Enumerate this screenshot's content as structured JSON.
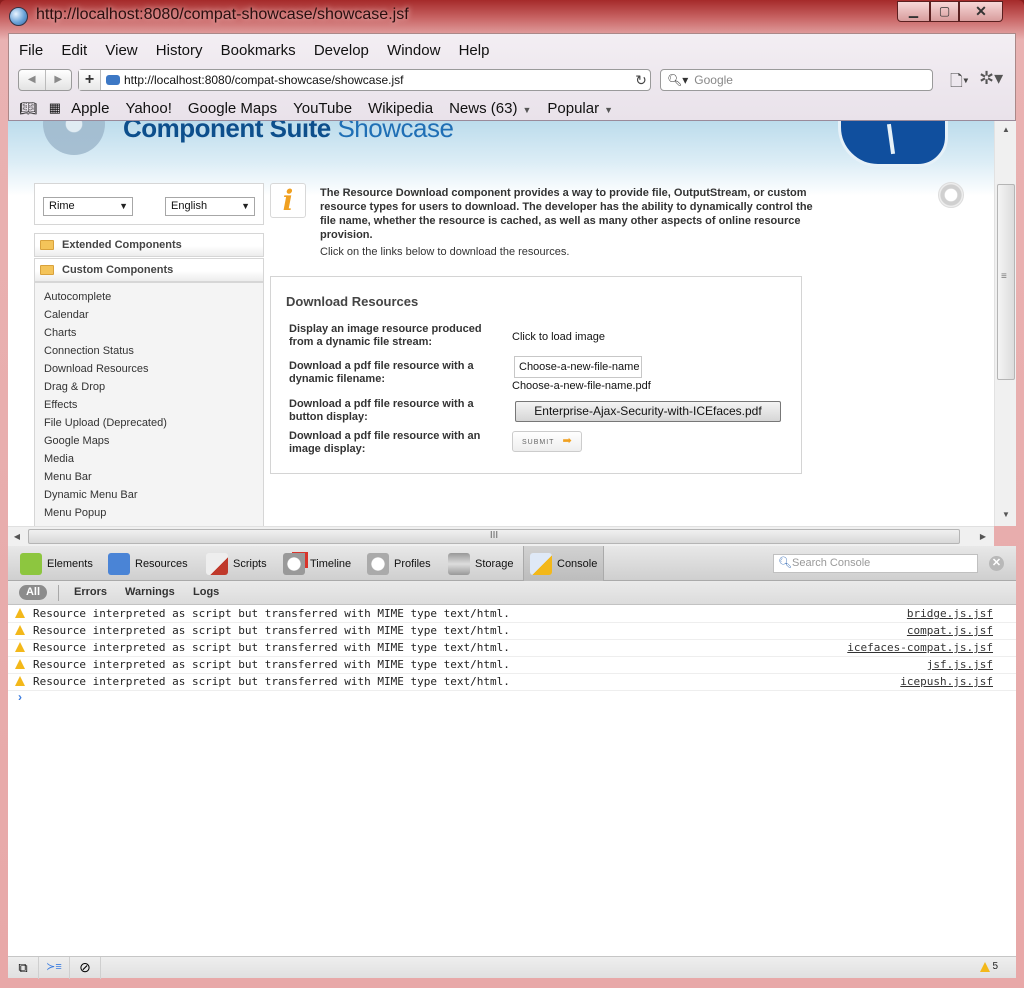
{
  "window": {
    "title": "http://localhost:8080/compat-showcase/showcase.jsf",
    "controls": {
      "minimize": "▁",
      "maximize": "▢",
      "close": "✕"
    }
  },
  "menubar": [
    "File",
    "Edit",
    "View",
    "History",
    "Bookmarks",
    "Develop",
    "Window",
    "Help"
  ],
  "toolbar": {
    "back_icon": "◀",
    "forward_icon": "▶",
    "add_icon": "+",
    "url": "http://localhost:8080/compat-showcase/showcase.jsf",
    "reload_icon": "↻",
    "search_icon": "🔍︎▾",
    "search_placeholder": "Google",
    "page_menu_icon": "🗋▾",
    "settings_icon": "✲▾"
  },
  "bookmarks": {
    "book_icon": "📖︎",
    "grid_icon": "▦",
    "items": [
      {
        "label": "Apple"
      },
      {
        "label": "Yahoo!"
      },
      {
        "label": "Google Maps"
      },
      {
        "label": "YouTube"
      },
      {
        "label": "Wikipedia"
      },
      {
        "label": "News (63)",
        "dropdown": true
      },
      {
        "label": "Popular",
        "dropdown": true
      }
    ],
    "caret": "▼"
  },
  "page": {
    "brand_bold": "Component Suite",
    "brand_light": " Showcase",
    "theme_select": "Rime",
    "language_select": "English",
    "select_arrow": "▼",
    "accordion": [
      "Extended Components",
      "Custom Components"
    ],
    "sidebar_items": [
      "Autocomplete",
      "Calendar",
      "Charts",
      "Connection Status",
      "Download Resources",
      "Drag & Drop",
      "Effects",
      "File Upload (Deprecated)",
      "Google Maps",
      "Media",
      "Menu Bar",
      "Dynamic Menu Bar",
      "Menu Popup"
    ],
    "info_icon": "i",
    "description": "The Resource Download component provides a way to provide file, OutputStream, or custom resource types for users to download. The developer has the ability to dynamically control the file name, whether the resource is cached, as well as many other aspects of online resource provision.",
    "description_sub": "Click on the links below to download the resources.",
    "panel": {
      "title": "Download Resources",
      "rows": [
        {
          "label": "Display an image resource produced from a dynamic file stream:",
          "value": "Click to load image"
        },
        {
          "label": "Download a pdf file resource with a dynamic filename:",
          "input_value": "Choose-a-new-file-name",
          "value": "Choose-a-new-file-name.pdf"
        },
        {
          "label": "Download a pdf file resource with a button display:",
          "button": "Enterprise-Ajax-Security-with-ICEfaces.pdf"
        },
        {
          "label": "Download a pdf file resource with an image display:",
          "image_button": "SUBMIT",
          "image_button_icon": "➡"
        }
      ]
    }
  },
  "scrollbars": {
    "up": "▲",
    "down": "▼",
    "left": "◀",
    "right": "▶",
    "grip_v": "≡",
    "grip_h": "III"
  },
  "inspector": {
    "tabs": [
      {
        "label": "Elements",
        "color": "#8dc63f"
      },
      {
        "label": "Resources",
        "color": "#4a84d6"
      },
      {
        "label": "Scripts",
        "color": "#c0392b"
      },
      {
        "label": "Timeline",
        "color": "#d9342b"
      },
      {
        "label": "Profiles",
        "color": "#b8b8b8"
      },
      {
        "label": "Storage",
        "color": "#8a8a8a"
      },
      {
        "label": "Console",
        "color": "#f3b81a",
        "active": true
      }
    ],
    "search_placeholder": "Search Console",
    "search_icon": "🔍︎",
    "clear_icon": "✕",
    "filters": [
      "All",
      "Errors",
      "Warnings",
      "Logs"
    ],
    "active_filter": "All",
    "messages": [
      {
        "level": "warning",
        "text": "Resource interpreted as script but transferred with MIME type text/html.",
        "source": "bridge.js.jsf"
      },
      {
        "level": "warning",
        "text": "Resource interpreted as script but transferred with MIME type text/html.",
        "source": "compat.js.jsf"
      },
      {
        "level": "warning",
        "text": "Resource interpreted as script but transferred with MIME type text/html.",
        "source": "icefaces-compat.js.jsf"
      },
      {
        "level": "warning",
        "text": "Resource interpreted as script but transferred with MIME type text/html.",
        "source": "jsf.js.jsf"
      },
      {
        "level": "warning",
        "text": "Resource interpreted as script but transferred with MIME type text/html.",
        "source": "icepush.js.jsf"
      }
    ],
    "prompt": "›",
    "status": {
      "dock_icon": "⧉",
      "console_icon": "≻≡",
      "clear_icon": "⃠",
      "warning_count": "5"
    }
  }
}
